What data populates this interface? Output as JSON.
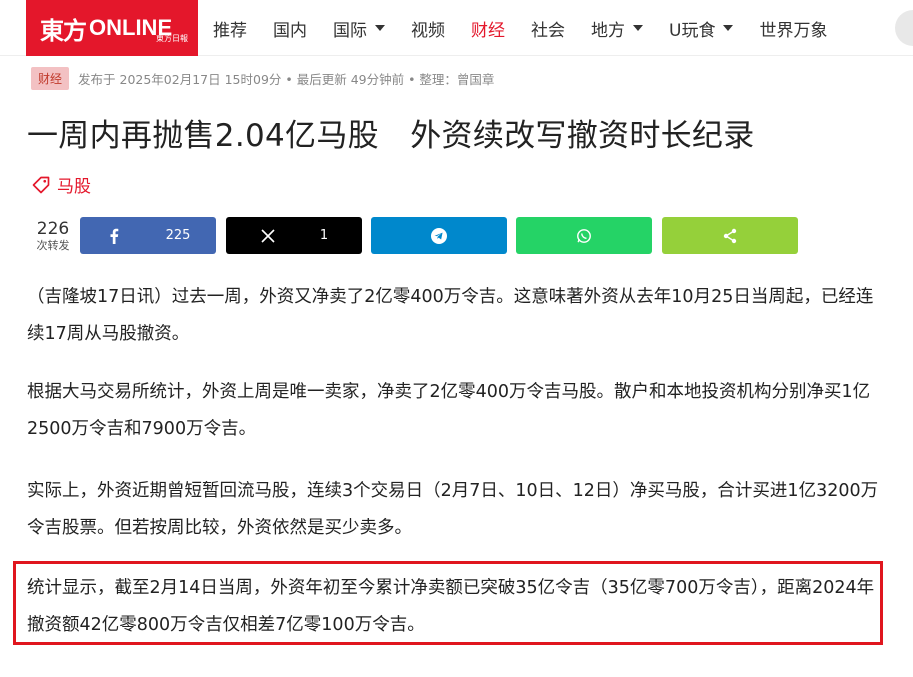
{
  "header": {
    "logo_mark": "東方",
    "logo_text": "ONLINE",
    "logo_sub": "東方日報",
    "nav": [
      {
        "label": "推荐",
        "dropdown": false,
        "active": false
      },
      {
        "label": "国内",
        "dropdown": false,
        "active": false
      },
      {
        "label": "国际",
        "dropdown": true,
        "active": false
      },
      {
        "label": "视频",
        "dropdown": false,
        "active": false
      },
      {
        "label": "财经",
        "dropdown": false,
        "active": true
      },
      {
        "label": "社会",
        "dropdown": false,
        "active": false
      },
      {
        "label": "地方",
        "dropdown": true,
        "active": false
      },
      {
        "label": "U玩食",
        "dropdown": true,
        "active": false
      },
      {
        "label": "世界万象",
        "dropdown": false,
        "active": false
      }
    ]
  },
  "meta": {
    "category": "财经",
    "text": "发布于 2025年02月17日 15时09分 • 最后更新 49分钟前 • 整理：曾国章"
  },
  "article": {
    "title": "一周内再抛售2.04亿马股　外资续改写撤资时长纪录",
    "tag": "马股",
    "paragraphs": [
      "（吉隆坡17日讯）过去一周，外资又净卖了2亿零400万令吉。这意味著外资从去年10月25日当周起，已经连续17周从马股撤资。",
      "根据大马交易所统计，外资上周是唯一卖家，净卖了2亿零400万令吉马股。散户和本地投资机构分别净买1亿2500万令吉和7900万令吉。",
      "实际上，外资近期曾短暂回流马股，连续3个交易日（2月7日、10日、12日）净买马股，合计买进1亿3200万令吉股票。但若按周比较，外资依然是买少卖多。",
      "统计显示，截至2月14日当周，外资年初至今累计净卖额已突破35亿令吉（35亿零700万令吉），距离2024年撤资额42亿零800万令吉仅相差7亿零100万令吉。"
    ]
  },
  "share": {
    "total": "226",
    "total_label": "次转发",
    "facebook": {
      "icon": "facebook-icon",
      "count": "225",
      "color": "#4267b2"
    },
    "x": {
      "icon": "x-icon",
      "count": "1",
      "color": "#000000"
    },
    "telegram": {
      "icon": "telegram-icon",
      "color": "#0088cc"
    },
    "whatsapp": {
      "icon": "whatsapp-icon",
      "color": "#25d366"
    },
    "sharethis": {
      "icon": "share-icon",
      "color": "#95d03a"
    }
  },
  "colors": {
    "brand_red": "#e4172b",
    "highlight_border": "#e0161e"
  }
}
